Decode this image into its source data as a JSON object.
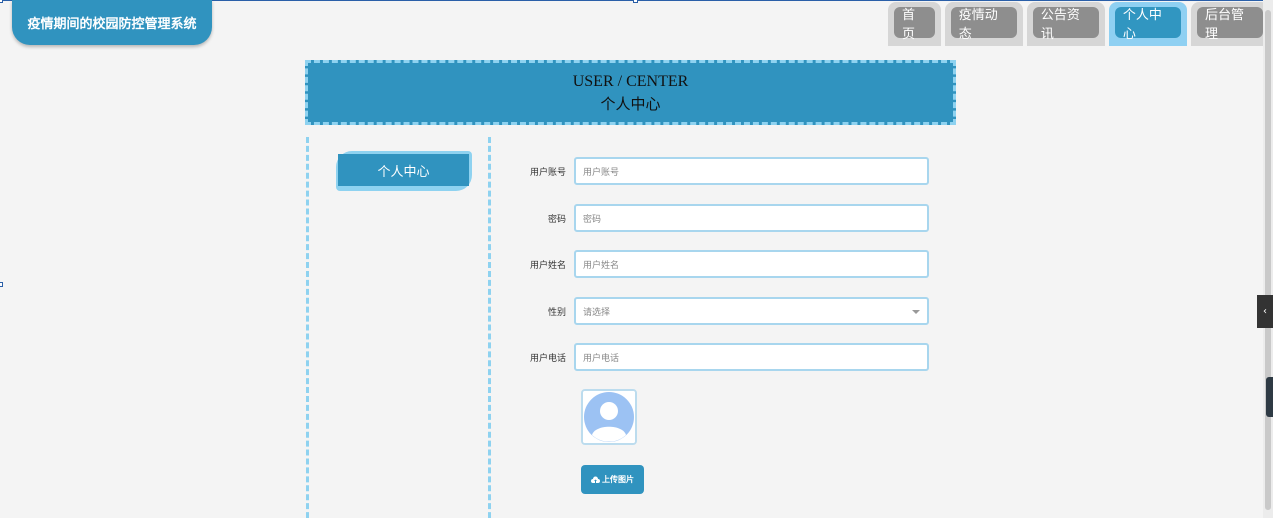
{
  "header": {
    "logo_text": "疫情期间的校园防控管理系统",
    "nav": [
      {
        "label": "首页",
        "active": false
      },
      {
        "label": "疫情动态",
        "active": false
      },
      {
        "label": "公告资讯",
        "active": false
      },
      {
        "label": "个人中心",
        "active": true
      },
      {
        "label": "后台管理",
        "active": false
      }
    ]
  },
  "banner": {
    "title_en": "USER / CENTER",
    "title_cn": "个人中心"
  },
  "sidebar": {
    "items": [
      {
        "label": "个人中心"
      }
    ]
  },
  "form": {
    "fields": [
      {
        "label": "用户账号",
        "placeholder": "用户账号",
        "type": "text"
      },
      {
        "label": "密码",
        "placeholder": "密码",
        "type": "text"
      },
      {
        "label": "用户姓名",
        "placeholder": "用户姓名",
        "type": "text"
      },
      {
        "label": "性别",
        "placeholder": "请选择",
        "type": "select"
      },
      {
        "label": "用户电话",
        "placeholder": "用户电话",
        "type": "text"
      }
    ],
    "upload_label": "上传图片"
  },
  "icons": {
    "avatar": "default-avatar-icon",
    "upload": "cloud-upload-icon",
    "collapse": "chevron-left-icon"
  },
  "colors": {
    "primary": "#3093bf",
    "accent_light": "#8ed2f0",
    "nav_inactive": "#8e8e8e"
  }
}
